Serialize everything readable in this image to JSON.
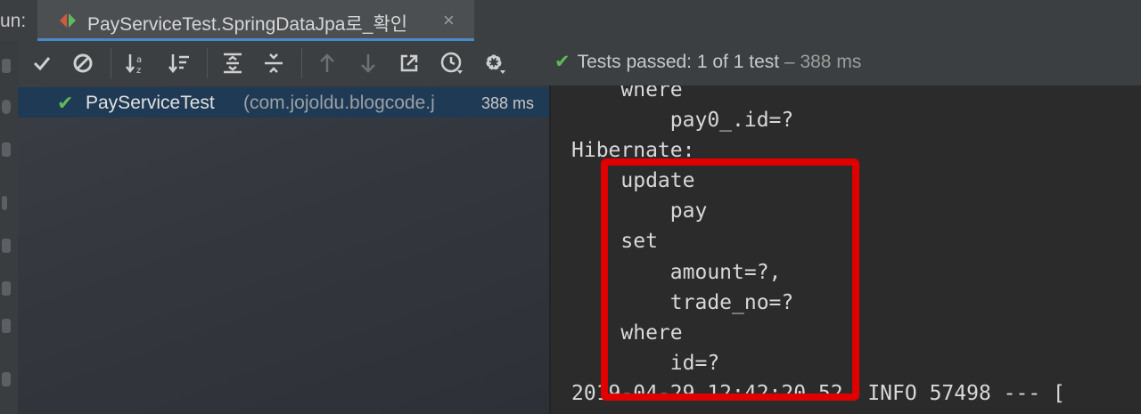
{
  "tabbar": {
    "run_label": "un:",
    "tab_title": "PayServiceTest.SpringDataJpa로_확인",
    "close_glyph": "×"
  },
  "toolbar": {
    "status_lead": "Tests passed:",
    "status_count": "1 of 1 test",
    "status_sep": " – ",
    "status_duration": "388 ms"
  },
  "tree": {
    "item_name": "PayServiceTest",
    "item_package": "(com.jojoldu.blogcode.j",
    "item_duration": "388 ms"
  },
  "console": {
    "lines": [
      "    where",
      "        pay0_.id=?",
      "Hibernate:",
      "    update",
      "        pay",
      "    set",
      "        amount=?,",
      "        trade_no=?",
      "    where",
      "        id=?",
      "2019-04-29 12:42:20.52  INFO 57498 --- ["
    ]
  },
  "colors": {
    "accent_green": "#5fb85a",
    "highlight_red": "#e00000",
    "selection_blue": "#1f3a54"
  }
}
